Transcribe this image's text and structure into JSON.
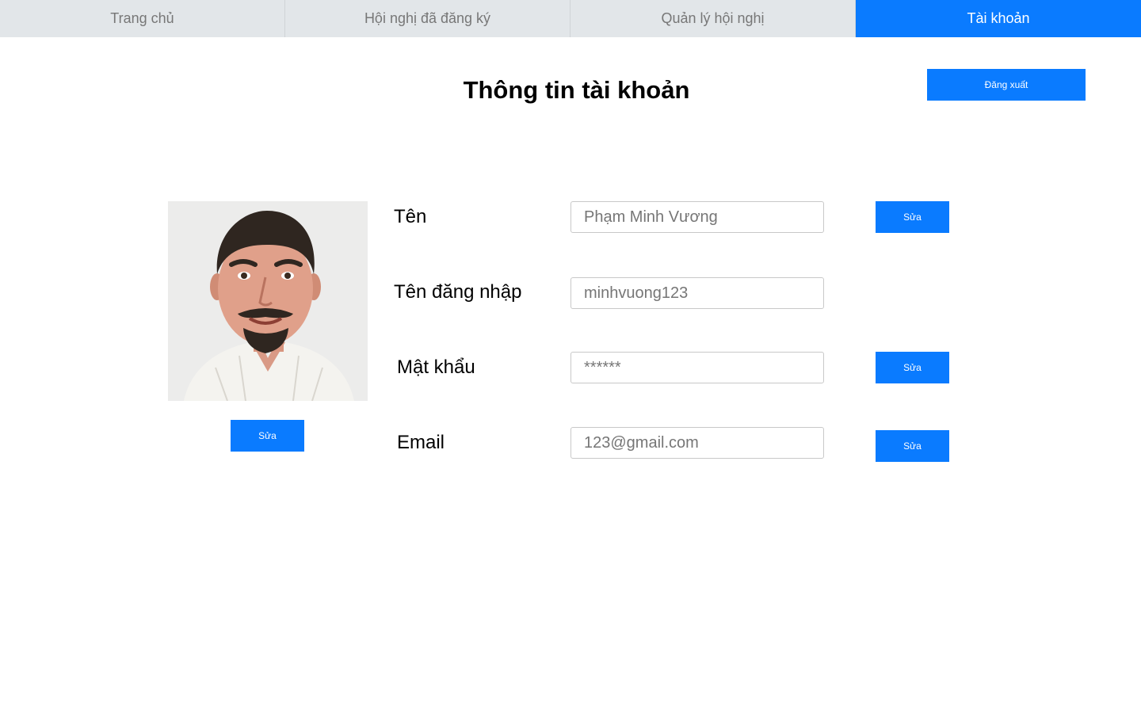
{
  "nav": {
    "tabs": [
      {
        "label": "Trang chủ",
        "active": false
      },
      {
        "label": "Hội nghị đã đăng ký",
        "active": false
      },
      {
        "label": "Quản lý hội nghị",
        "active": false
      },
      {
        "label": "Tài khoản",
        "active": true
      }
    ]
  },
  "header": {
    "title": "Thông tin tài khoản",
    "logout_label": "Đăng xuất"
  },
  "profile": {
    "avatar_edit_label": "Sửa",
    "fields": {
      "name": {
        "label": "Tên",
        "value": "Phạm Minh Vương",
        "edit_label": "Sửa"
      },
      "username": {
        "label": "Tên đăng nhập",
        "value": "minhvuong123"
      },
      "password": {
        "label": "Mật khẩu",
        "value": "******",
        "edit_label": "Sửa"
      },
      "email": {
        "label": "Email",
        "value": "123@gmail.com",
        "edit_label": "Sửa"
      }
    }
  },
  "colors": {
    "accent": "#0a7bff",
    "nav_bg": "#e2e6e9",
    "nav_text": "#777777"
  }
}
